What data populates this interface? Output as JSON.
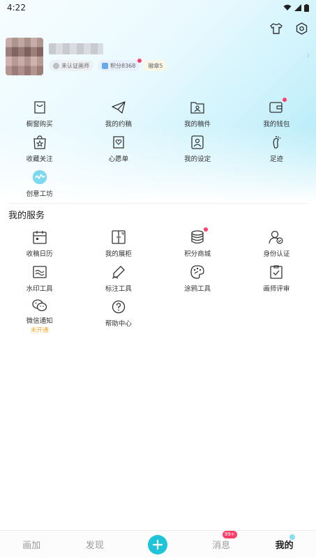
{
  "status_bar": {
    "time": "4:22"
  },
  "profile": {
    "badges": {
      "cert": "未认证画师",
      "points": "积分8368",
      "medal": "徽章5"
    }
  },
  "menu": [
    {
      "label": "橱窗购买",
      "icon": "bag-icon"
    },
    {
      "label": "我的约稿",
      "icon": "paper-plane-icon"
    },
    {
      "label": "我的稿件",
      "icon": "folder-user-icon"
    },
    {
      "label": "我的钱包",
      "icon": "wallet-icon"
    },
    {
      "label": "收藏关注",
      "icon": "star-bag-icon"
    },
    {
      "label": "心愿单",
      "icon": "wishlist-icon"
    },
    {
      "label": "我的设定",
      "icon": "profile-card-icon"
    },
    {
      "label": "足迹",
      "icon": "footprint-icon"
    },
    {
      "label": "创意工坊",
      "icon": "creative-workshop-icon"
    }
  ],
  "services": {
    "title": "我的服务",
    "items": [
      {
        "label": "收稿日历",
        "icon": "calendar-icon"
      },
      {
        "label": "我的展柜",
        "icon": "cabinet-icon"
      },
      {
        "label": "积分商城",
        "icon": "coins-icon"
      },
      {
        "label": "身份认证",
        "icon": "user-check-icon"
      },
      {
        "label": "水印工具",
        "icon": "watermark-icon"
      },
      {
        "label": "标注工具",
        "icon": "pen-icon"
      },
      {
        "label": "涂鸦工具",
        "icon": "palette-icon"
      },
      {
        "label": "画师评审",
        "icon": "review-icon"
      },
      {
        "label": "微信通知",
        "icon": "wechat-icon",
        "sub": "未开通"
      },
      {
        "label": "帮助中心",
        "icon": "help-icon"
      }
    ]
  },
  "tabs": {
    "draw": "画加",
    "discover": "发现",
    "messages": "消息",
    "messages_badge": "99+",
    "mine": "我的"
  },
  "colors": {
    "accent": "#20c4d8",
    "badge_red": "#ff3d6b"
  }
}
